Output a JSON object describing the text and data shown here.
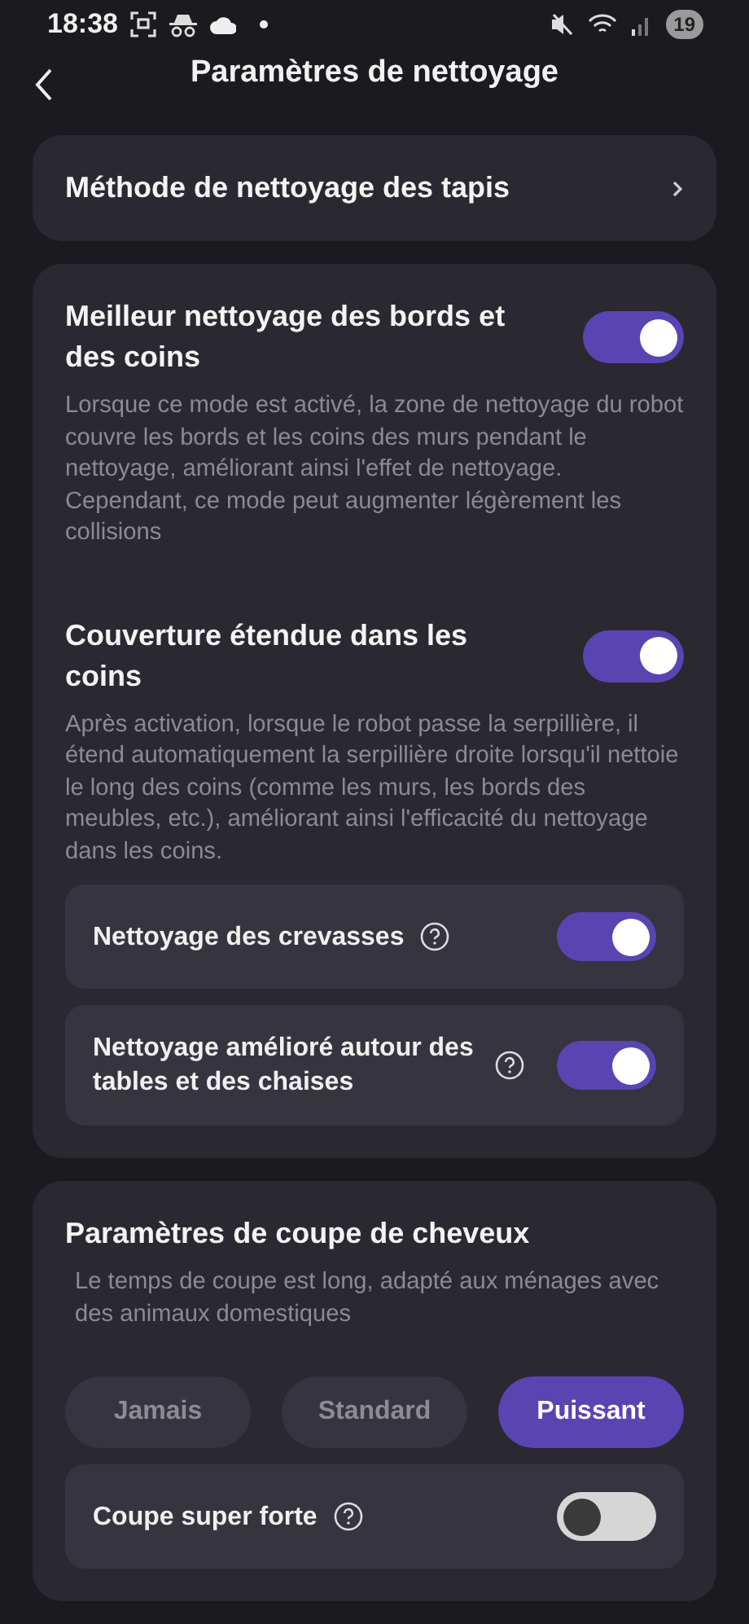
{
  "status_bar": {
    "time": "18:38",
    "battery": "19"
  },
  "header": {
    "title": "Paramètres de nettoyage"
  },
  "carpet_row": {
    "label": "Méthode de nettoyage des tapis"
  },
  "edge_settings": [
    {
      "title": "Meilleur nettoyage des bords et des coins",
      "on": true,
      "description": "Lorsque ce mode est activé, la zone de nettoyage du robot couvre les bords et les coins des murs pendant le nettoyage, améliorant ainsi l'effet de nettoyage. Cependant, ce mode peut augmenter légèrement les collisions"
    },
    {
      "title": "Couverture étendue dans les coins",
      "on": true,
      "description": "Après activation, lorsque le robot passe la serpillière, il étend automatiquement la serpillière droite lorsqu'il nettoie le long des coins (comme les murs, les bords des meubles, etc.), améliorant ainsi l'efficacité du nettoyage dans les coins.",
      "sub_settings": [
        {
          "label": "Nettoyage des crevasses",
          "on": true
        },
        {
          "label": "Nettoyage amélioré autour des tables et des chaises",
          "on": true
        }
      ]
    }
  ],
  "hair_cutting": {
    "title": "Paramètres de coupe de cheveux",
    "description": "Le temps de coupe est long, adapté aux ménages avec des animaux domestiques",
    "options": [
      {
        "label": "Jamais",
        "selected": false
      },
      {
        "label": "Standard",
        "selected": false
      },
      {
        "label": "Puissant",
        "selected": true
      }
    ],
    "sub_settings": [
      {
        "label": "Coupe super forte",
        "on": false
      }
    ]
  }
}
